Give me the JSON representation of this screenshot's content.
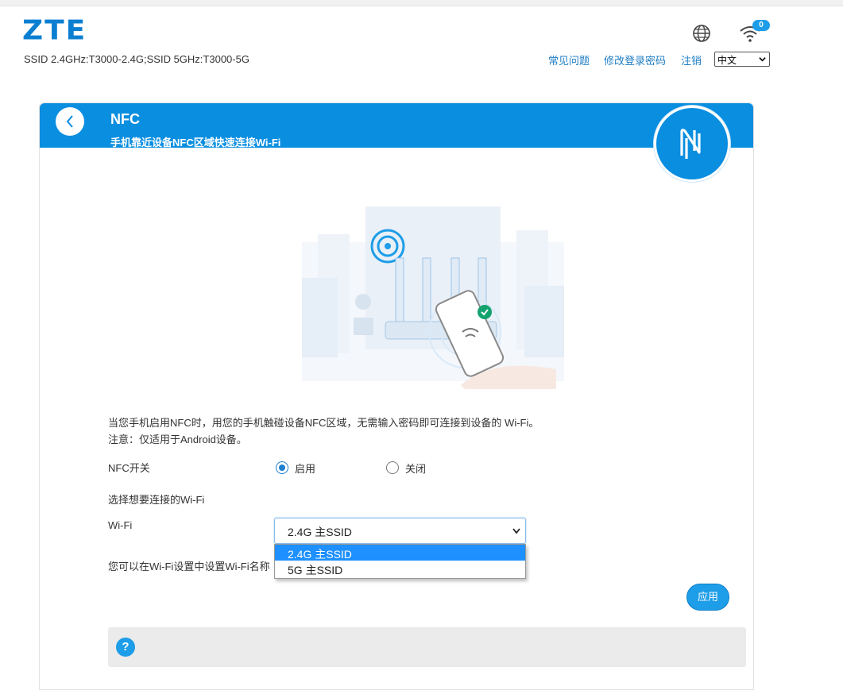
{
  "header": {
    "logo": "ZTE",
    "ssid_info": "SSID 2.4GHz:T3000-2.4G;SSID 5GHz:T3000-5G",
    "wifi_badge_count": "0",
    "links": [
      "常见问题",
      "修改登录密码",
      "注销"
    ],
    "language_selected": "中文",
    "icons": [
      "globe-icon",
      "wifi-icon"
    ]
  },
  "card": {
    "title": "NFC",
    "subtitle": "手机靠近设备NFC区域快速连接Wi-Fi",
    "description_line1": "当您手机启用NFC时，用您的手机触碰设备NFC区域，无需输入密码即可连接到设备的 Wi-Fi。",
    "description_line2": "注意：仅适用于Android设备。",
    "nfc_switch_label": "NFC开关",
    "radio_on_label": "启用",
    "radio_off_label": "关闭",
    "nfc_enabled": true,
    "choose_wifi_label": "选择想要连接的Wi-Fi",
    "wifi_label": "Wi-Fi",
    "wifi_selected": "2.4G 主SSID",
    "wifi_options": [
      "2.4G 主SSID",
      "5G 主SSID"
    ],
    "hint_text": "您可以在Wi-Fi设置中设置Wi-Fi名称",
    "apply_label": "应用",
    "help_icon_glyph": "?"
  },
  "colors": {
    "brand_blue": "#0a8ee0",
    "logo_blue": "#0a7fd2",
    "link_blue": "#1d7dc4",
    "button_blue": "#1e9de8"
  }
}
